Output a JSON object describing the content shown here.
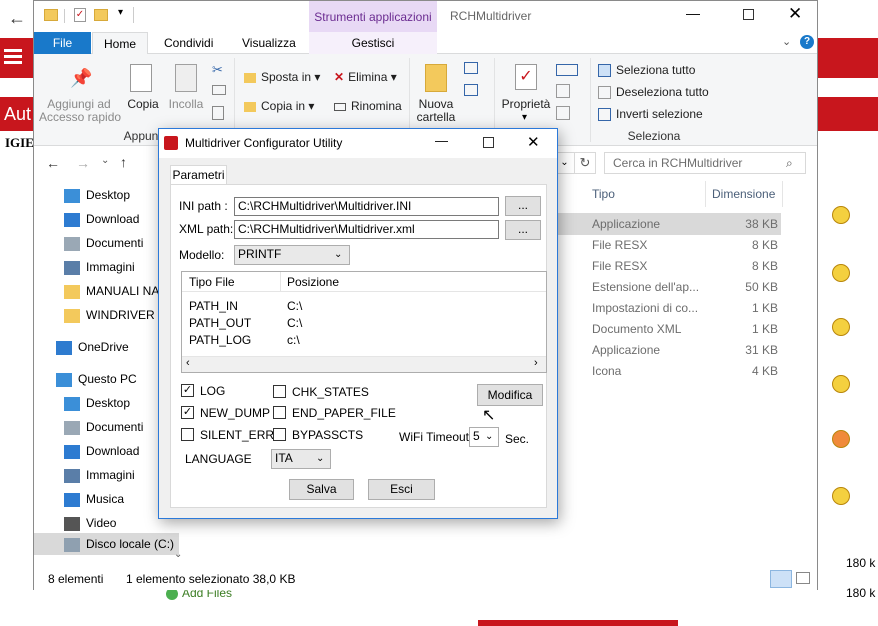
{
  "background_app": {
    "title_fragment": "Aut",
    "sub_fragment": "IGIE",
    "add_files": "Add Files",
    "sizes": [
      "180 k",
      "180 k"
    ]
  },
  "explorer": {
    "title": "RCHMultidriver",
    "context_tab": "Strumenti applicazioni",
    "context_subtab": "Gestisci",
    "tabs": [
      "File",
      "Home",
      "Condividi",
      "Visualizza"
    ],
    "ribbon": {
      "pin_label": "Aggiungi ad\nAccesso rapido",
      "copy_label": "Copia",
      "paste_label": "Incolla",
      "clipboard_group": "Appunti",
      "move_to": "Sposta in",
      "copy_to": "Copia in",
      "delete": "Elimina",
      "rename": "Rinomina",
      "new_folder": "Nuova\ncartella",
      "properties": "Proprietà",
      "select_all": "Seleziona tutto",
      "deselect_all": "Deseleziona tutto",
      "invert_selection": "Inverti selezione",
      "select_group": "Seleziona"
    },
    "search_placeholder": "Cerca in RCHMultidriver",
    "columns": {
      "type": "Tipo",
      "size": "Dimensione"
    },
    "nav_items": [
      {
        "label": "Desktop",
        "icon": "desktop-icon"
      },
      {
        "label": "Download",
        "icon": "download-icon"
      },
      {
        "label": "Documenti",
        "icon": "documents-icon"
      },
      {
        "label": "Immagini",
        "icon": "pictures-icon"
      },
      {
        "label": "MANUALI NA",
        "icon": "folder-icon"
      },
      {
        "label": "WINDRIVER P",
        "icon": "folder-icon"
      },
      {
        "label": "OneDrive",
        "icon": "onedrive-icon"
      },
      {
        "label": "Questo PC",
        "icon": "computer-icon"
      },
      {
        "label": "Desktop",
        "icon": "desktop-icon"
      },
      {
        "label": "Documenti",
        "icon": "documents-icon"
      },
      {
        "label": "Download",
        "icon": "download-icon"
      },
      {
        "label": "Immagini",
        "icon": "pictures-icon"
      },
      {
        "label": "Musica",
        "icon": "music-icon"
      },
      {
        "label": "Video",
        "icon": "video-icon"
      },
      {
        "label": "Disco locale (C:)",
        "icon": "drive-icon"
      }
    ],
    "files": [
      {
        "type": "Applicazione",
        "size": "38 KB"
      },
      {
        "type": "File RESX",
        "size": "8 KB"
      },
      {
        "type": "File RESX",
        "size": "8 KB"
      },
      {
        "type": "Estensione dell'ap...",
        "size": "50 KB"
      },
      {
        "type": "Impostazioni di co...",
        "size": "1 KB"
      },
      {
        "type": "Documento XML",
        "size": "1 KB"
      },
      {
        "type": "Applicazione",
        "size": "31 KB"
      },
      {
        "type": "Icona",
        "size": "4 KB"
      }
    ],
    "status_items": "8 elementi",
    "status_selected": "1 elemento selezionato  38,0 KB"
  },
  "dialog": {
    "title": "Multidriver Configurator Utility",
    "tab": "Parametri",
    "ini_label": "INI path :",
    "ini_value": "C:\\RCHMultidriver\\Multidriver.INI",
    "xml_label": "XML path:",
    "xml_value": "C:\\RCHMultidriver\\Multidriver.xml",
    "browse": "...",
    "model_label": "Modello:",
    "model_value": "PRINTF",
    "table_headers": [
      "Tipo File",
      "Posizione"
    ],
    "table_rows": [
      [
        "PATH_IN",
        "C:\\"
      ],
      [
        "PATH_OUT",
        "C:\\"
      ],
      [
        "PATH_LOG",
        "c:\\"
      ]
    ],
    "checkboxes": {
      "log": {
        "label": "LOG",
        "checked": true
      },
      "new_dump": {
        "label": "NEW_DUMP",
        "checked": true
      },
      "silent_err": {
        "label": "SILENT_ERR",
        "checked": false
      },
      "chk_states": {
        "label": "CHK_STATES",
        "checked": false
      },
      "end_paper_file": {
        "label": "END_PAPER_FILE",
        "checked": false
      },
      "bypasscts": {
        "label": "BYPASSCTS",
        "checked": false
      }
    },
    "modify_button": "Modifica",
    "wifi_label": "WiFi Timeout",
    "wifi_value": "5",
    "wifi_unit": "Sec.",
    "language_label": "LANGUAGE",
    "language_value": "ITA",
    "save_button": "Salva",
    "exit_button": "Esci"
  }
}
